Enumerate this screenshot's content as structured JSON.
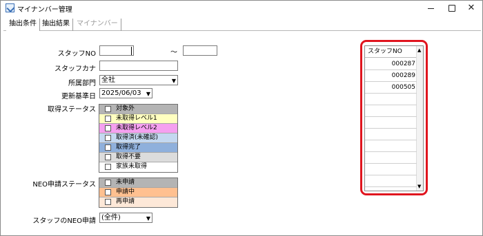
{
  "window": {
    "title": "マイナンバー管理",
    "close_glyph": "✕"
  },
  "tabs": [
    {
      "label": "抽出条件",
      "state": "active"
    },
    {
      "label": "抽出結果",
      "state": "normal"
    },
    {
      "label": "マイナンバー",
      "state": "disabled"
    }
  ],
  "form": {
    "staff_no_label": "スタッフNO",
    "staff_no_from": "",
    "range_sep": "～",
    "staff_no_to": "",
    "staff_kana_label": "スタッフカナ",
    "staff_kana_value": "",
    "dept_label": "所属部門",
    "dept_value": "全社",
    "update_date_label": "更新基準日",
    "update_date_value": "2025/06/03",
    "acq_status_label": "取得ステータス",
    "acq_status_items": [
      {
        "label": "対象外",
        "color": "#b4b4b4"
      },
      {
        "label": "未取得レベル1",
        "color": "#ffffc0"
      },
      {
        "label": "未取得レベル2",
        "color": "#f5a0f0"
      },
      {
        "label": "取得済(未確認)",
        "color": "#c4d8f0"
      },
      {
        "label": "取得完了",
        "color": "#8fb0dc"
      },
      {
        "label": "取得不要",
        "color": "#dcdcdc"
      },
      {
        "label": "家族未取得",
        "color": "#ffffff"
      }
    ],
    "neo_status_label": "NEO申請ステータス",
    "neo_status_items": [
      {
        "label": "未申請",
        "color": "#b4b4b4"
      },
      {
        "label": "申請中",
        "color": "#ffc090"
      },
      {
        "label": "再申請",
        "color": "#fde8d8"
      }
    ],
    "staff_neo_label": "スタッフのNEO申請",
    "staff_neo_value": "(全件)"
  },
  "staff_list": {
    "header": "スタッフNO",
    "rows": [
      "000287",
      "000289",
      "000505",
      "",
      "",
      "",
      "",
      "",
      "",
      "",
      ""
    ]
  },
  "colors": {
    "highlight": "#e0141e"
  }
}
